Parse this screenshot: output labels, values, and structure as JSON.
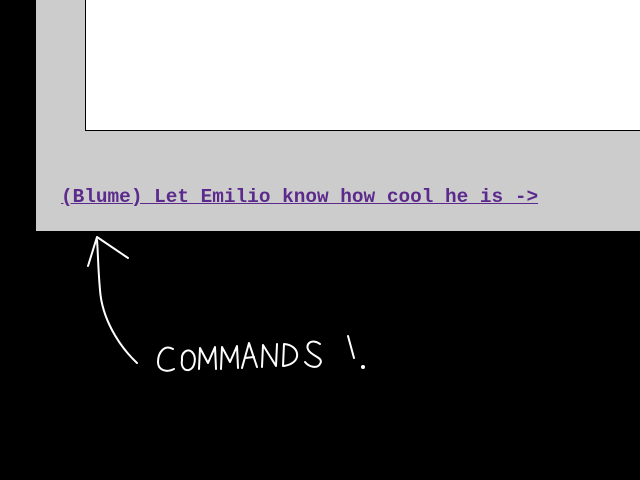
{
  "game": {
    "text_area_content": "",
    "command_link": "(Blume) Let Emilio know how cool he is ->"
  },
  "annotation": {
    "label": "COMMANDS!"
  },
  "colors": {
    "background": "#000000",
    "panel": "#cccccc",
    "text_area": "#ffffff",
    "link": "#5b2a8c",
    "annotation_stroke": "#ffffff"
  }
}
